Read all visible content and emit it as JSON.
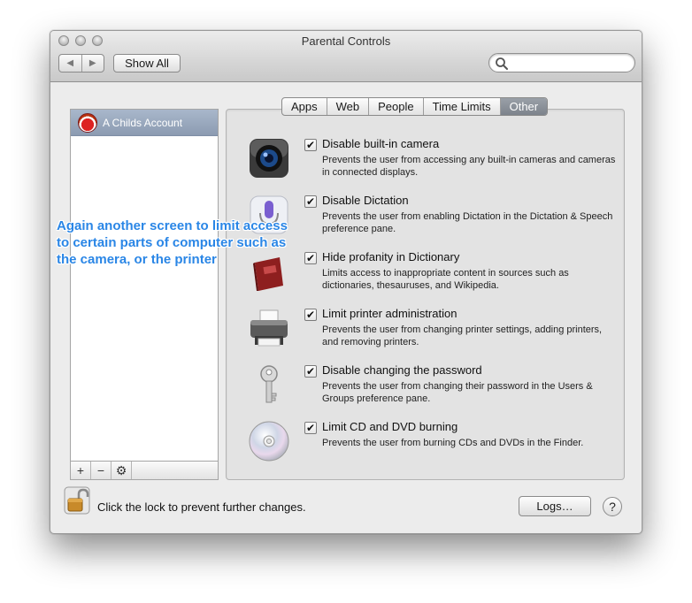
{
  "window": {
    "title": "Parental Controls"
  },
  "toolbar": {
    "back_glyph": "◀",
    "forward_glyph": "▶",
    "show_all_label": "Show All",
    "search": {
      "placeholder": "",
      "value": ""
    }
  },
  "sidebar": {
    "accounts": [
      {
        "name": "A Childs Account",
        "selected": true
      }
    ],
    "toolbar": {
      "add": "+",
      "remove": "−",
      "action_glyph": "⚙"
    }
  },
  "tabs": [
    {
      "label": "Apps",
      "selected": false
    },
    {
      "label": "Web",
      "selected": false
    },
    {
      "label": "People",
      "selected": false
    },
    {
      "label": "Time Limits",
      "selected": false
    },
    {
      "label": "Other",
      "selected": true
    }
  ],
  "options": [
    {
      "icon": "camera-icon",
      "title": "Disable built-in camera",
      "checked": true,
      "description": "Prevents the user from accessing any built-in cameras and cameras in connected displays."
    },
    {
      "icon": "microphone-icon",
      "title": "Disable Dictation",
      "checked": true,
      "description": "Prevents the user from enabling Dictation in the Dictation & Speech preference pane."
    },
    {
      "icon": "dictionary-icon",
      "title": "Hide profanity in Dictionary",
      "checked": true,
      "description": "Limits access to inappropriate content in sources such as dictionaries, thesauruses, and Wikipedia."
    },
    {
      "icon": "printer-icon",
      "title": "Limit printer administration",
      "checked": true,
      "description": "Prevents the user from changing printer settings, adding printers, and removing printers."
    },
    {
      "icon": "key-icon",
      "title": "Disable changing the password",
      "checked": true,
      "description": "Prevents the user from changing their password in the Users & Groups preference pane."
    },
    {
      "icon": "disc-icon",
      "title": "Limit CD and DVD burning",
      "checked": true,
      "description": "Prevents the user from burning CDs and DVDs in the Finder."
    }
  ],
  "check_glyph": "✔",
  "annotation": "Again another screen to limit access to certain parts of computer such as the camera, or the printer",
  "footer": {
    "lock_text": "Click the lock to prevent further changes.",
    "logs_label": "Logs…",
    "help_label": "?"
  },
  "colors": {
    "annotation": "#2a86e6",
    "selected_tab": "#878d96",
    "selected_row": "#9aa9bf"
  }
}
